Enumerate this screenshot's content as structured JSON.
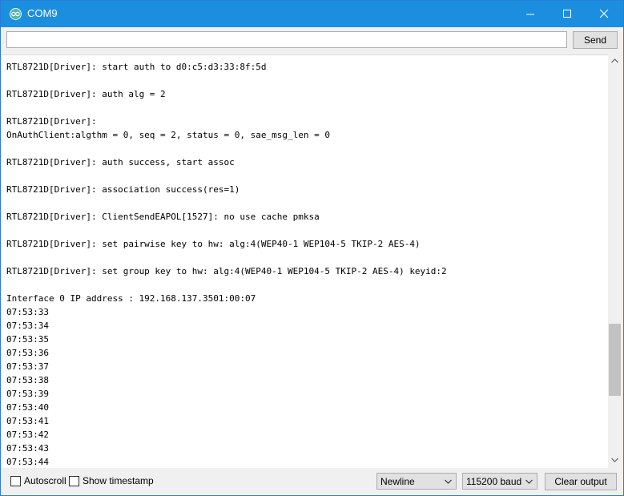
{
  "window": {
    "title": "COM9",
    "icon": "arduino-icon",
    "controls": [
      "minimize-icon",
      "maximize-icon",
      "close-icon"
    ]
  },
  "toolbar": {
    "input_value": "",
    "send_label": "Send"
  },
  "output": {
    "lines": [
      "RTL8721D[Driver]: start auth to d0:c5:d3:33:8f:5d",
      "",
      "RTL8721D[Driver]: auth alg = 2",
      "",
      "RTL8721D[Driver]:",
      "OnAuthClient:algthm = 0, seq = 2, status = 0, sae_msg_len = 0",
      "",
      "RTL8721D[Driver]: auth success, start assoc",
      "",
      "RTL8721D[Driver]: association success(res=1)",
      "",
      "RTL8721D[Driver]: ClientSendEAPOL[1527]: no use cache pmksa",
      "",
      "RTL8721D[Driver]: set pairwise key to hw: alg:4(WEP40-1 WEP104-5 TKIP-2 AES-4)",
      "",
      "RTL8721D[Driver]: set group key to hw: alg:4(WEP40-1 WEP104-5 TKIP-2 AES-4) keyid:2",
      "",
      "Interface 0 IP address : 192.168.137.3501:00:07",
      "07:53:33",
      "07:53:34",
      "07:53:35",
      "07:53:36",
      "07:53:37",
      "07:53:38",
      "07:53:39",
      "07:53:40",
      "07:53:41",
      "07:53:42",
      "07:53:43",
      "07:53:44"
    ]
  },
  "statusbar": {
    "autoscroll_label": "Autoscroll",
    "autoscroll_checked": false,
    "timestamp_label": "Show timestamp",
    "timestamp_checked": false,
    "line_ending": "Newline",
    "baud": "115200 baud",
    "clear_label": "Clear output"
  },
  "colors": {
    "titlebar": "#1c8ee0",
    "accent": "#2b7bd6"
  }
}
